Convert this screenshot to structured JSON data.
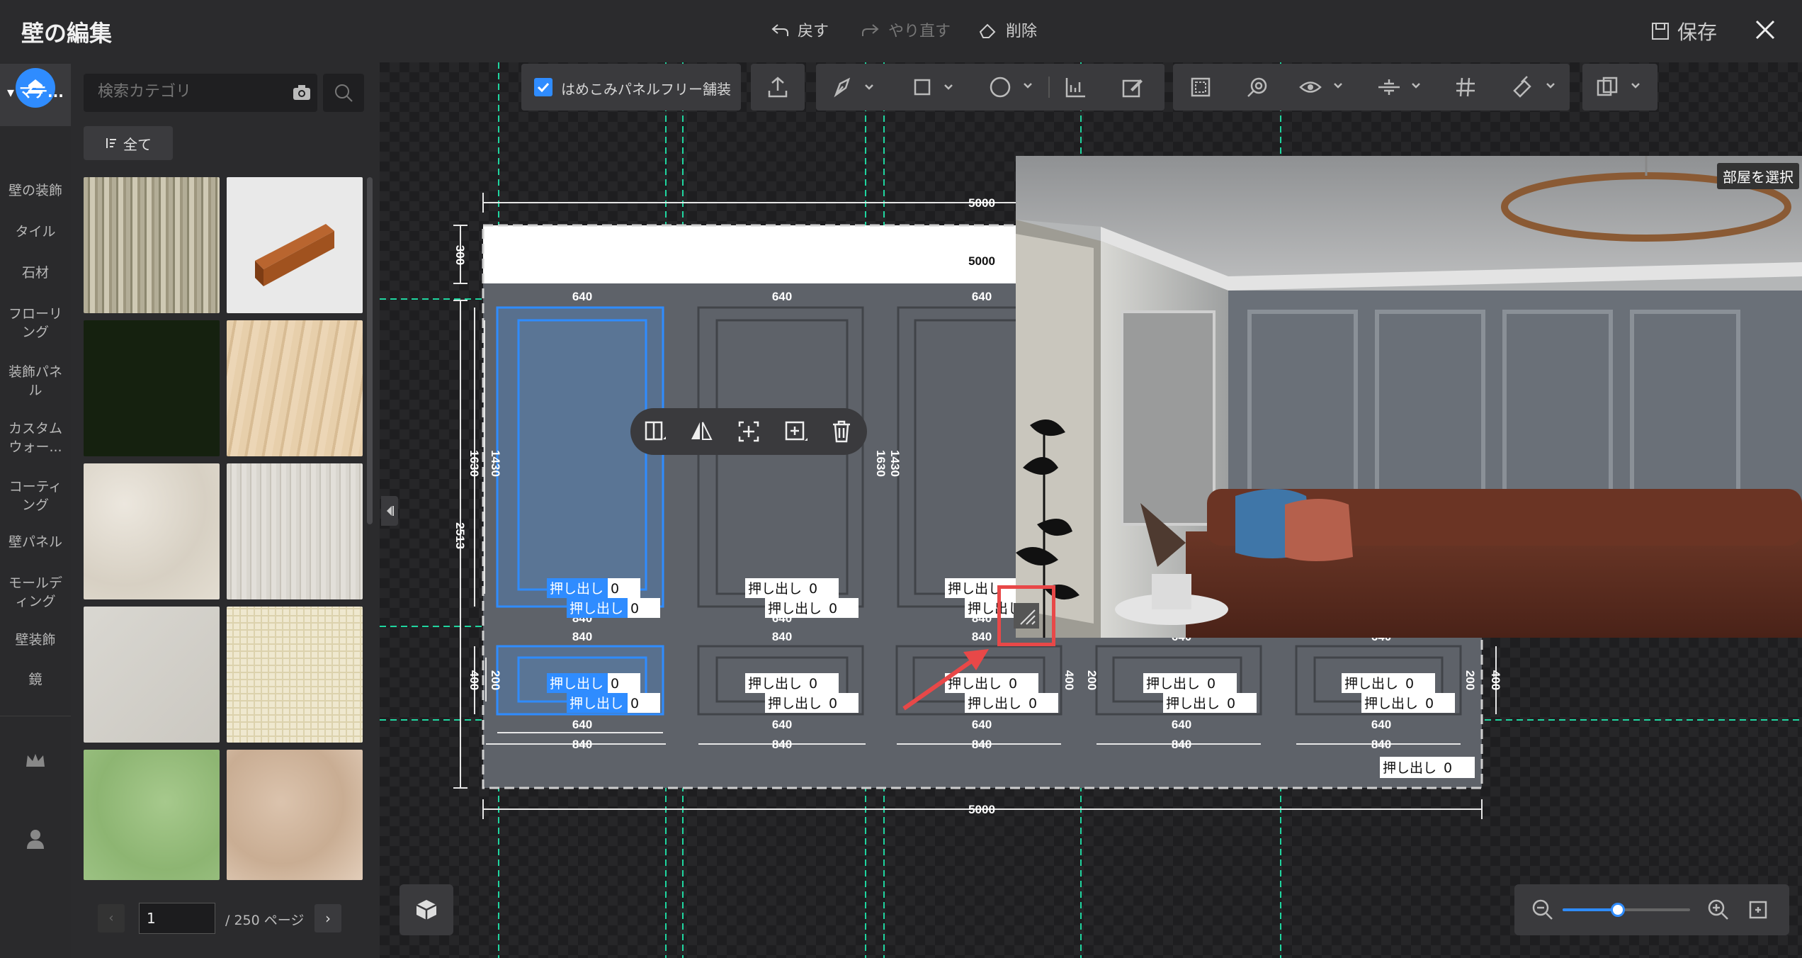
{
  "app": {
    "title": "壁の編集"
  },
  "header": {
    "undo": "戻す",
    "redo": "やり直す",
    "delete": "削除",
    "save": "保存"
  },
  "rail": {
    "active_icon": "home-icon",
    "section": "▾ マテ...",
    "items": [
      "壁の装飾",
      "タイル",
      "石材",
      "フローリング",
      "装飾パネル",
      "カスタムウォー...",
      "コーティング",
      "壁パネル",
      "モールディング",
      "壁装飾",
      "鏡"
    ],
    "bottom_icons": [
      "crown-icon",
      "user-icon"
    ]
  },
  "panel": {
    "search_placeholder": "検索カテゴリ",
    "all_label": "全て",
    "thumbs": [
      "wood-grain",
      "baseboard",
      "dark-green",
      "light-oak",
      "beige-stone",
      "white-oak",
      "light-gray",
      "checker",
      "green-plaster",
      "beige-marble"
    ],
    "page_value": "1",
    "page_total": "/ 250 ページ"
  },
  "toolbar": {
    "fill_label": "はめこみパネルフリー舗装",
    "fill_checked": true
  },
  "preview": {
    "room_select": "部屋を選択"
  },
  "drawing": {
    "width_top": "5000",
    "width_bottom": "5000",
    "width_inner": "5000",
    "height_top_band": "300",
    "height_total": "2513",
    "panel_outer": "840",
    "panel_inner": "640",
    "panel_height_outer": "1630",
    "panel_height_inner": "1430",
    "lower_outer": "400",
    "lower_inner": "200",
    "extrude_label": "押し出し",
    "extrude_value": "0"
  },
  "colors": {
    "accent": "#2f8cff",
    "guide": "#1fd6a0",
    "highlight": "#e84848"
  }
}
